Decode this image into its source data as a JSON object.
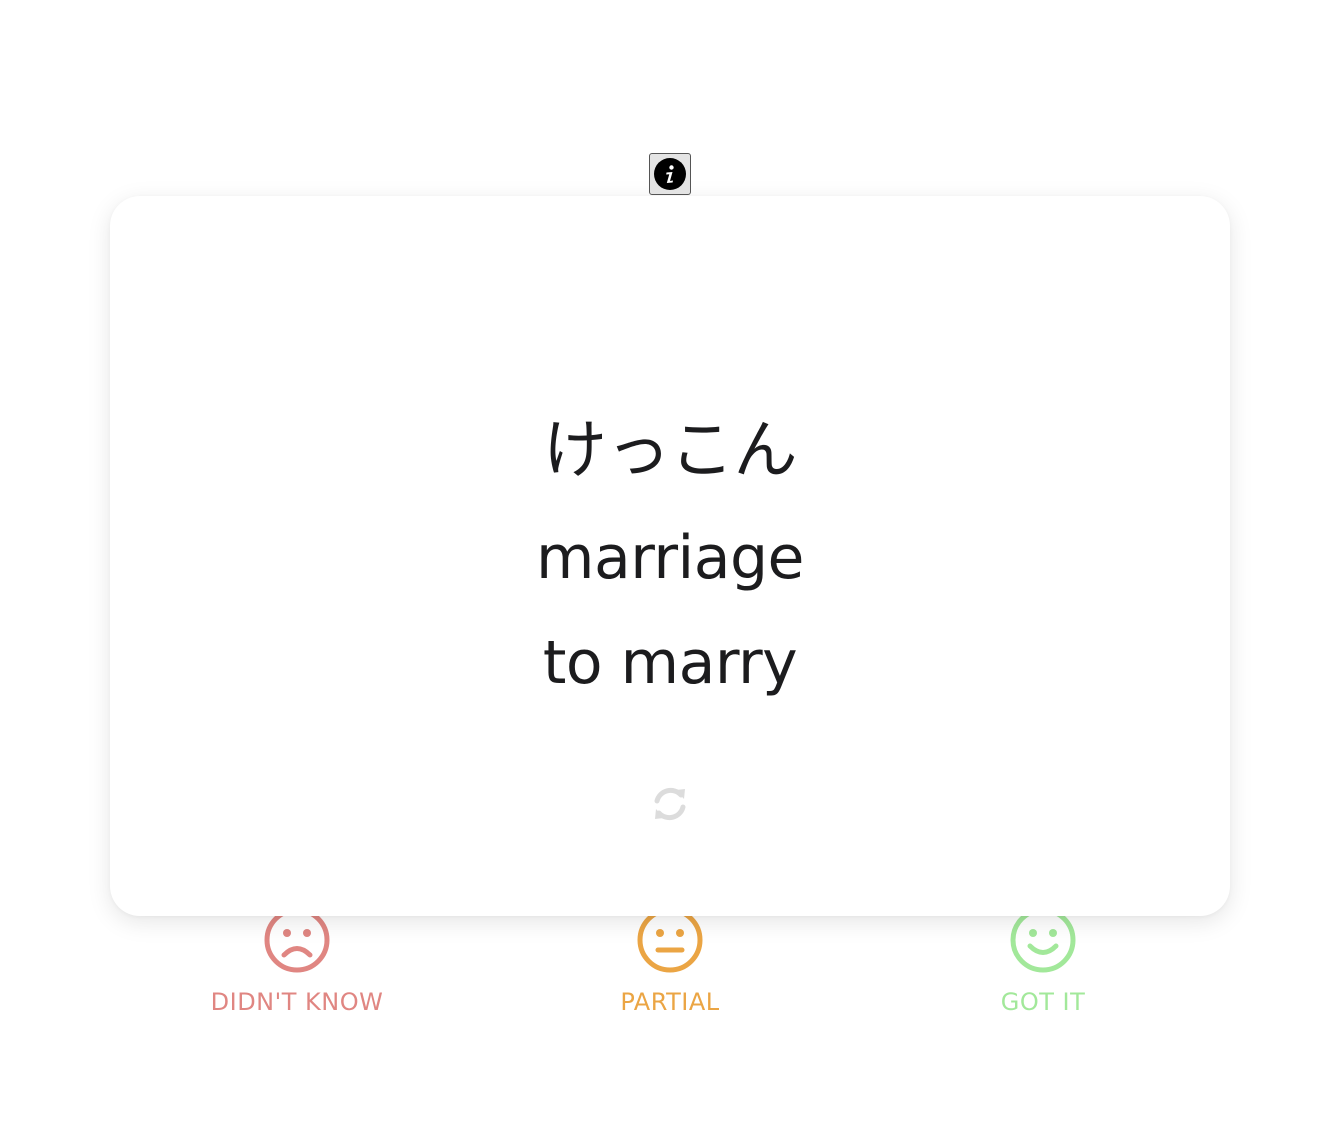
{
  "card": {
    "reading": "けっこん",
    "meanings": [
      "marriage",
      "to marry"
    ]
  },
  "icons": {
    "info": "info-icon",
    "flip": "flip-card-icon",
    "sad": "sad-face-icon",
    "neutral": "neutral-face-icon",
    "happy": "happy-face-icon"
  },
  "ratings": [
    {
      "label": "DIDN'T KNOW",
      "color": "#e08682"
    },
    {
      "label": "PARTIAL",
      "color": "#eba544"
    },
    {
      "label": "GOT IT",
      "color": "#a2e89a"
    }
  ],
  "colors": {
    "card_text": "#1c1c1e",
    "flip_icon": "#dcdcdc",
    "card_background": "#ffffff"
  }
}
